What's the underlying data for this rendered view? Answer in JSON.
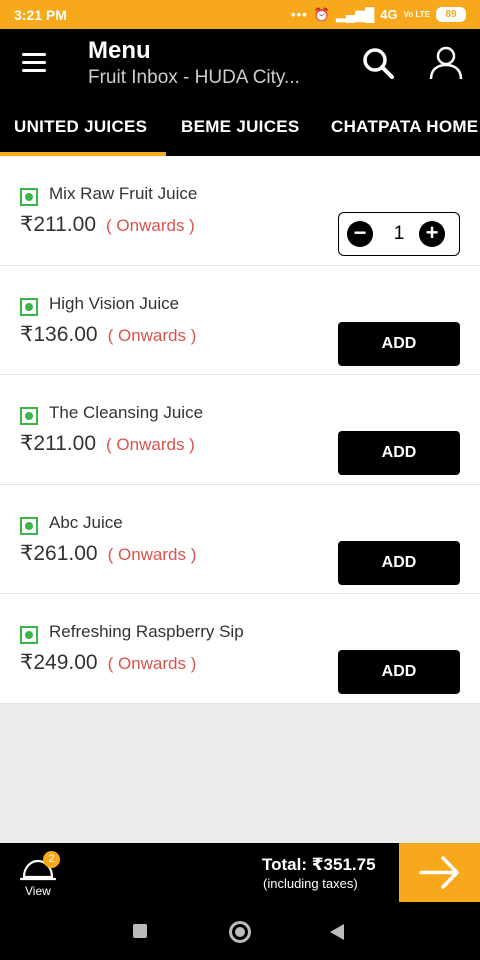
{
  "status_bar": {
    "time": "3:21 PM",
    "network": "4G",
    "volte": "Vo LTE",
    "battery": "89"
  },
  "header": {
    "title": "Menu",
    "subtitle": "Fruit Inbox - HUDA City..."
  },
  "tabs": [
    {
      "label": "UNITED JUICES",
      "active": true
    },
    {
      "label": "BEME JUICES",
      "active": false
    },
    {
      "label": "CHATPATA HOME",
      "active": false
    }
  ],
  "items": [
    {
      "name": "Mix Raw Fruit Juice",
      "price": "₹211.00",
      "note": "( Onwards )",
      "quantity": "1",
      "button": ""
    },
    {
      "name": "High Vision Juice",
      "price": "₹136.00",
      "note": "( Onwards )",
      "button": "ADD"
    },
    {
      "name": "The Cleansing Juice",
      "price": "₹211.00",
      "note": "( Onwards )",
      "button": "ADD"
    },
    {
      "name": "Abc Juice",
      "price": "₹261.00",
      "note": "( Onwards )",
      "button": "ADD"
    },
    {
      "name": "Refreshing Raspberry Sip",
      "price": "₹249.00",
      "note": "( Onwards )",
      "button": "ADD"
    }
  ],
  "cart": {
    "count": "2",
    "view_label": "View",
    "total": "Total: ₹351.75",
    "taxes": "(including taxes)"
  },
  "colors": {
    "accent": "#f7a91b",
    "veg": "#3bb54a",
    "onwards": "#d9534f"
  }
}
